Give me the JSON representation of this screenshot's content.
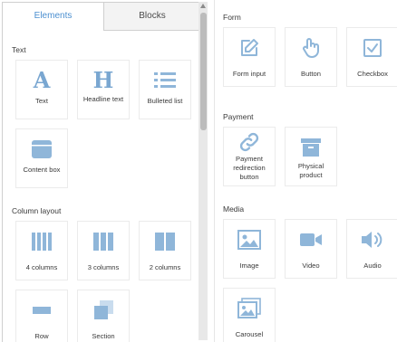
{
  "tabs": {
    "elements": "Elements",
    "blocks": "Blocks"
  },
  "sections": {
    "text": "Text",
    "column_layout": "Column layout",
    "form": "Form",
    "payment": "Payment",
    "media": "Media"
  },
  "tiles": {
    "letter_a": "A",
    "letter_h": "H",
    "text": "Text",
    "headline_text": "Headline text",
    "bulleted_list": "Bulleted list",
    "content_box": "Content box",
    "four_columns": "4 columns",
    "three_columns": "3 columns",
    "two_columns": "2 columns",
    "row": "Row",
    "section": "Section",
    "form_input": "Form input",
    "button": "Button",
    "checkbox": "Checkbox",
    "payment_redirection_button": "Payment redirection button",
    "physical_product": "Physical product",
    "image": "Image",
    "video": "Video",
    "audio": "Audio",
    "carousel": "Carousel"
  },
  "colors": {
    "accent": "#4b8fd0",
    "icon": "#8fb6d9",
    "icon_dark": "#7aa7d1"
  }
}
